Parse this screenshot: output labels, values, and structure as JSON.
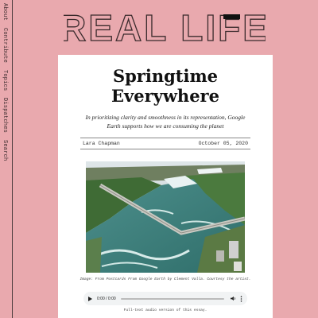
{
  "site": {
    "logo_text": "REAL LIFE"
  },
  "nav": {
    "items": [
      "About",
      "Contribute",
      "Topics",
      "Dispatches",
      "Search"
    ]
  },
  "article": {
    "title_line1": "Springtime",
    "title_line2": "Everywhere",
    "subtitle": "In prioritizing clarity and smoothness in its representation, Google Earth supports how we are consuming the planet",
    "author": "Lara Chapman",
    "date": "October 05, 2020",
    "image_caption": "Image: From Postcards From Google Earth by Clement Valla. Courtesy the artist.",
    "audio": {
      "time": "0:00 / 0:00",
      "progress": 0
    },
    "audio_note": "Full-text audio version of this essay."
  },
  "colors": {
    "background": "#e9a9ae",
    "card": "#ffffff",
    "text": "#111111"
  },
  "icons": {
    "play": "play-icon",
    "volume": "volume-icon",
    "more": "more-options-icon"
  }
}
